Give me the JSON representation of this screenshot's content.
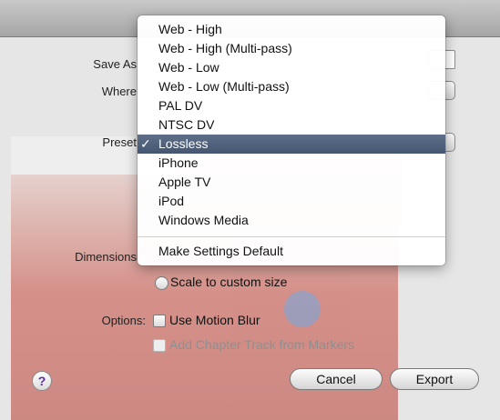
{
  "labels": {
    "save_as": "Save As",
    "where": "Where",
    "preset": "Preset",
    "dimensions": "Dimensions",
    "options": "Options:"
  },
  "dimensions": {
    "scale_custom": "Scale to custom size"
  },
  "options": {
    "motion_blur": "Use Motion Blur",
    "chapter_track": "Add Chapter Track from Markers"
  },
  "buttons": {
    "help": "?",
    "cancel": "Cancel",
    "export": "Export"
  },
  "preset_menu": {
    "items": [
      "Web - High",
      "Web - High (Multi-pass)",
      "Web - Low",
      "Web - Low (Multi-pass)",
      "PAL DV",
      "NTSC DV",
      "Lossless",
      "iPhone",
      "Apple TV",
      "iPod",
      "Windows Media"
    ],
    "selected": "Lossless",
    "checkmark": "✓",
    "footer": "Make Settings Default"
  }
}
